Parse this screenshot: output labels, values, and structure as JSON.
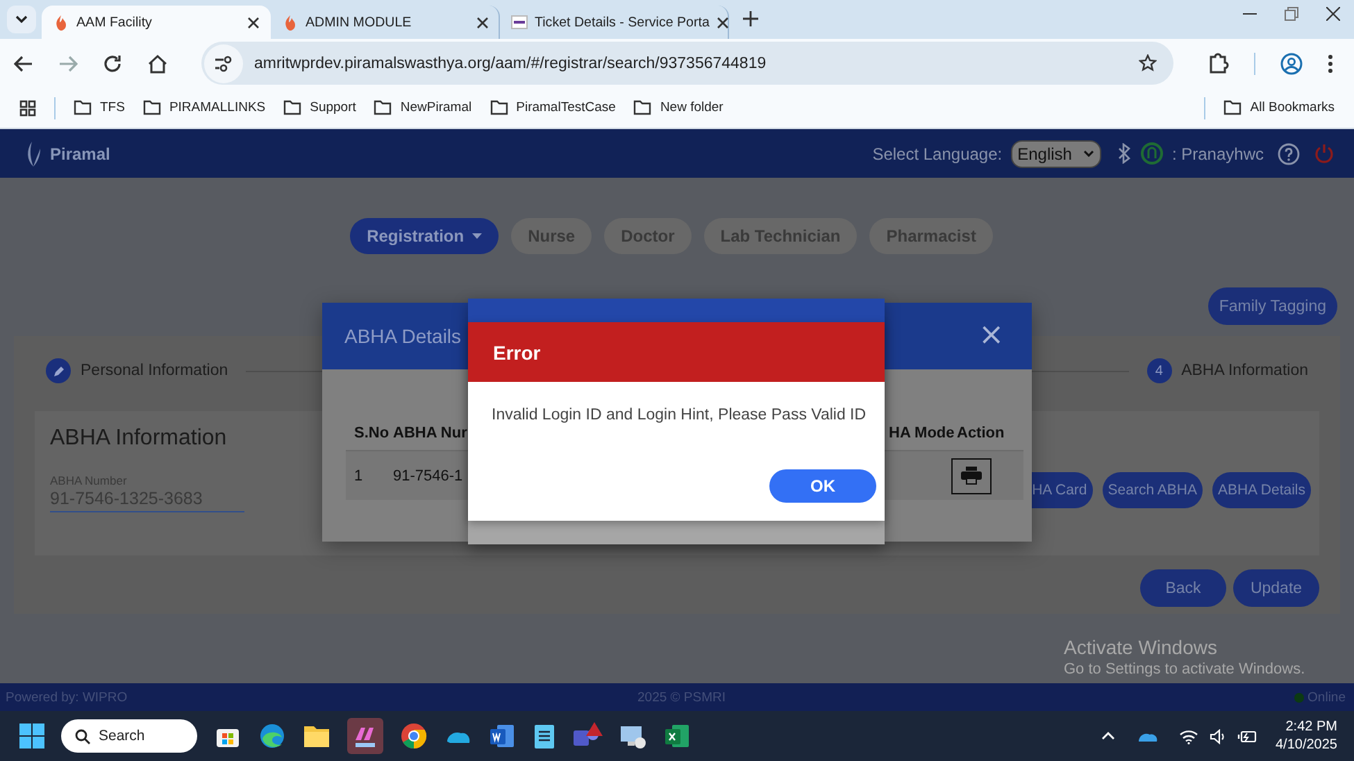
{
  "browser": {
    "tabs": [
      {
        "title": "AAM Facility",
        "selected": true
      },
      {
        "title": "ADMIN MODULE",
        "selected": false
      },
      {
        "title": "Ticket Details - Service Porta",
        "selected": false
      }
    ],
    "address": "amritwprdev.piramalswasthya.org/aam/#/registrar/search/937356744819",
    "bookmarks": [
      "TFS",
      "PIRAMALLINKS",
      "Support",
      "NewPiramal",
      "PiramalTestCase",
      "New folder"
    ],
    "all_bookmarks": "All Bookmarks"
  },
  "app": {
    "logo": "Piramal",
    "language_label": "Select Language:",
    "language": "English",
    "user": ": Pranayhwc",
    "roles": [
      {
        "label": "Registration",
        "selected": true
      },
      {
        "label": "Nurse",
        "selected": false
      },
      {
        "label": "Doctor",
        "selected": false
      },
      {
        "label": "Lab Technician",
        "selected": false
      },
      {
        "label": "Pharmacist",
        "selected": false
      }
    ],
    "family_tagging": "Family Tagging",
    "steps": [
      {
        "kind": "edit",
        "label": "Personal Information"
      },
      {
        "kind": "number",
        "number": "4",
        "label": "ABHA Information"
      }
    ],
    "abha_info": {
      "title": "ABHA Information",
      "field_label": "ABHA Number",
      "value": "91-7546-1325-3683"
    },
    "actions": [
      "HA Card",
      "Search ABHA",
      "ABHA Details"
    ],
    "nav_buttons": [
      "Back",
      "Update"
    ]
  },
  "abha_modal": {
    "title": "ABHA Details",
    "close": "×",
    "columns": [
      "S.No",
      "ABHA Nur",
      "HA Mode",
      "Action"
    ],
    "row": [
      "1",
      "91-7546-1"
    ]
  },
  "error_dialog": {
    "title": "Error",
    "message": "Invalid Login ID and Login Hint, Please Pass Valid ID",
    "button": "OK"
  },
  "watermark": {
    "title": "Activate Windows",
    "subtitle": "Go to Settings to activate Windows."
  },
  "footer": {
    "left": "Powered by: WIPRO",
    "center": "2025 © PSMRI",
    "status": "Online"
  },
  "taskbar": {
    "search": "Search",
    "time": "2:42 PM",
    "date": "4/10/2025"
  }
}
